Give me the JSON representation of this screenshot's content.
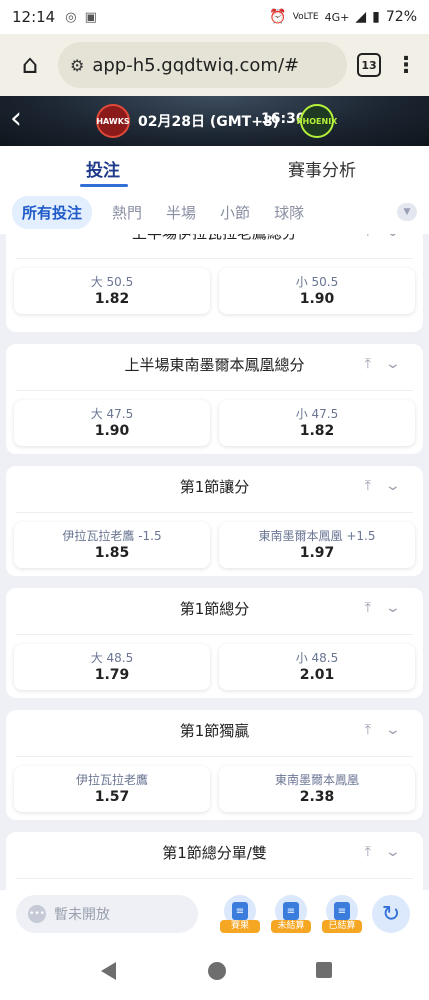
{
  "status_bar": {
    "time": "12:14",
    "battery": "72%",
    "network": "4G+",
    "volte": "VoLTE"
  },
  "browser": {
    "url": "app-h5.gqdtwiq.com/#",
    "tab_count": "13"
  },
  "match": {
    "date": "02月28日 (GMT+8)",
    "time": "16:30",
    "home_logo_text": "HAWKS",
    "away_logo_text": "PHOENIX"
  },
  "tabs": {
    "bet": "投注",
    "analysis": "賽事分析"
  },
  "filters": [
    "所有投注",
    "熱門",
    "半場",
    "小節",
    "球隊"
  ],
  "markets": [
    {
      "title": "上半場伊拉瓦拉老鷹總分",
      "left": {
        "label": "大 50.5",
        "price": "1.82"
      },
      "right": {
        "label": "小 50.5",
        "price": "1.90"
      }
    },
    {
      "title": "上半場東南墨爾本鳳凰總分",
      "left": {
        "label": "大 47.5",
        "price": "1.90"
      },
      "right": {
        "label": "小 47.5",
        "price": "1.82"
      }
    },
    {
      "title": "第1節讓分",
      "left": {
        "label": "伊拉瓦拉老鷹 -1.5",
        "price": "1.85"
      },
      "right": {
        "label": "東南墨爾本鳳凰 +1.5",
        "price": "1.97"
      }
    },
    {
      "title": "第1節總分",
      "left": {
        "label": "大 48.5",
        "price": "1.79"
      },
      "right": {
        "label": "小 48.5",
        "price": "2.01"
      }
    },
    {
      "title": "第1節獨贏",
      "left": {
        "label": "伊拉瓦拉老鷹",
        "price": "1.57"
      },
      "right": {
        "label": "東南墨爾本鳳凰",
        "price": "2.38"
      }
    },
    {
      "title": "第1節總分單/雙"
    }
  ],
  "bottom": {
    "closed_label": "暫未開放",
    "results": "賽果",
    "unsettled": "未結算",
    "settled": "已結算"
  },
  "colors": {
    "accent": "#2f6fd6",
    "tag": "#f5a623",
    "bet_tab": "#1f3a8a"
  }
}
